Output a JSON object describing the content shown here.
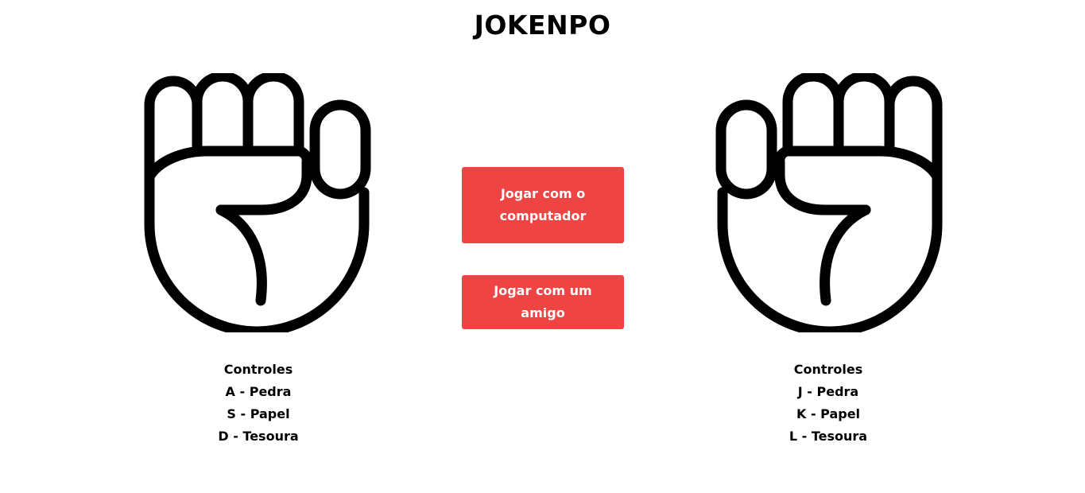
{
  "header": {
    "title": "JOKENPO"
  },
  "buttons": {
    "computer_label": "Jogar com o computador",
    "friend_label": "Jogar com um amigo",
    "color": "#ef4444"
  },
  "player_left": {
    "hand_icon": "fist-rock-icon",
    "controls_title": "Controles",
    "controls": [
      "A - Pedra",
      "S - Papel",
      "D - Tesoura"
    ]
  },
  "player_right": {
    "hand_icon": "fist-rock-icon",
    "controls_title": "Controles",
    "controls": [
      "J - Pedra",
      "K - Papel",
      "L - Tesoura"
    ]
  }
}
